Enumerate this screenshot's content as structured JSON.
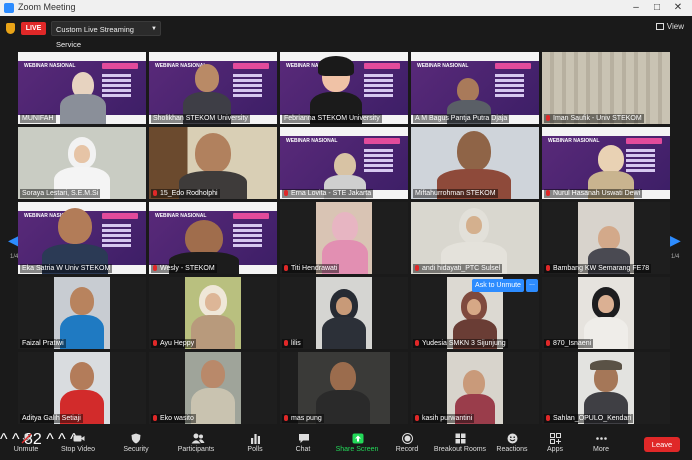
{
  "window": {
    "title": "Zoom Meeting",
    "minimize": "–",
    "maximize": "□",
    "close": "✕"
  },
  "topbar": {
    "live_label": "LIVE",
    "stream_select": "Custom Live Streaming Service",
    "view_label": "View"
  },
  "pagination": {
    "left": "1/4",
    "right": "1/4"
  },
  "participants": [
    {
      "name": "MUNIFAH",
      "muted": false
    },
    {
      "name": "Sholikhan STEKOM University",
      "muted": false
    },
    {
      "name": "Febrianna STEKOM University",
      "muted": false
    },
    {
      "name": "A M Bagus Pantja Putra Djaja",
      "muted": false
    },
    {
      "name": "Iman Saufik - Univ STEKOM",
      "muted": true
    },
    {
      "name": "Soraya Lestari, S.E.M.Si",
      "muted": false
    },
    {
      "name": "15_Edo Rodholphi",
      "muted": true
    },
    {
      "name": "Erna Lovita - STE Jakarta",
      "muted": true
    },
    {
      "name": "Miftahurrohman STEKOM",
      "muted": false
    },
    {
      "name": "Nurul Hasanah Uswati Dewi",
      "muted": true
    },
    {
      "name": "Eka Satria W Univ STEKOM",
      "muted": false
    },
    {
      "name": "Wesly - STEKOM",
      "muted": true
    },
    {
      "name": "Titi Hendrawati",
      "muted": true
    },
    {
      "name": "andi hidayati_PTC Sulsel",
      "muted": true
    },
    {
      "name": "Bambang KW Semarang FE78",
      "muted": true
    },
    {
      "name": "Faizal Pratiwi",
      "muted": false
    },
    {
      "name": "Ayu Heppy",
      "muted": true
    },
    {
      "name": "lilis",
      "muted": true
    },
    {
      "name": "Yudesia SMKN 3 Sijunjung",
      "muted": true
    },
    {
      "name": "870_Isnaeni",
      "muted": true
    },
    {
      "name": "Aditya Galih Setiaji",
      "muted": false
    },
    {
      "name": "Eko wasito",
      "muted": true
    },
    {
      "name": "mas pung",
      "muted": true
    },
    {
      "name": "kasih purwantini",
      "muted": true
    },
    {
      "name": "Sahlan_OPULO_Kendari",
      "muted": true
    }
  ],
  "ask_unmute": {
    "label": "Ask to Unmute",
    "more": "..."
  },
  "slide": {
    "heading": "WEBINAR NASIONAL"
  },
  "toolbar": {
    "unmute": "Unmute",
    "stop_video": "Stop Video",
    "security": "Security",
    "participants": "Participants",
    "participants_count": "82",
    "polls": "Polls",
    "chat": "Chat",
    "share_screen": "Share Screen",
    "record": "Record",
    "breakout_rooms": "Breakout Rooms",
    "reactions": "Reactions",
    "apps": "Apps",
    "more": "More",
    "leave": "Leave"
  },
  "colors": {
    "accent": "#2d8cff",
    "live": "#e02828",
    "share": "#23d959",
    "speaker": "#9ccc3c"
  }
}
